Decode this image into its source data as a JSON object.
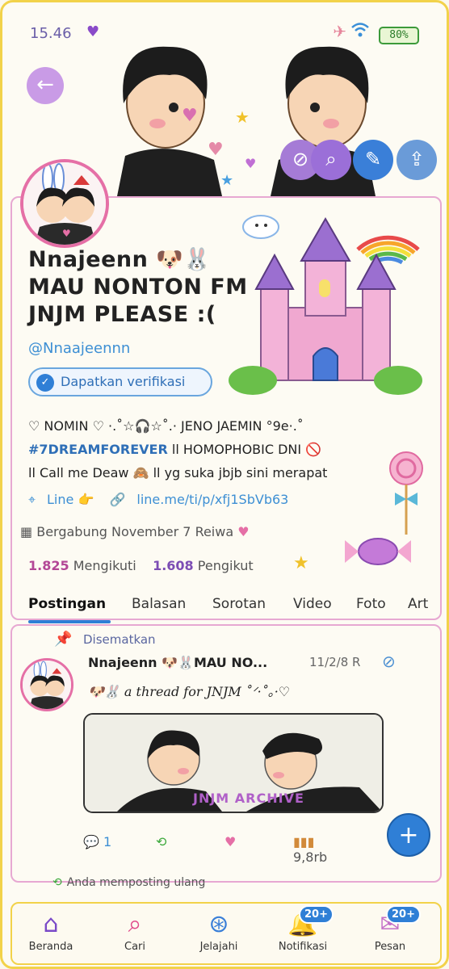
{
  "status_bar": {
    "time": "15.46",
    "battery": "80%"
  },
  "profile": {
    "display_name": "Nnajeenn 🐶🐰",
    "name_line2": "MAU NONTON FM",
    "name_line3": "JNJM PLEASE :(",
    "handle": "@Nnaajeennn",
    "verify_label": "Dapatkan verifikasi",
    "bio_line1": "♡ NOMIN ♡ ·.˚☆🎧☆˚.· JENO JAEMIN °9e·.˚",
    "bio_tag": "#7DREAMFOREVER",
    "bio_line2_rest": " ll HOMOPHOBIC DNI ",
    "bio_no_symbol": "🚫",
    "bio_line3": "ll Call me Deaw 🙈 ll yg suka jbjb sini merapat",
    "location": "Line 👉",
    "link": "line.me/ti/p/xfj1SbVb63",
    "joined": "Bergabung November 7 Reiwa",
    "following_count": "1.825",
    "following_label": "Mengikuti",
    "followers_count": "1.608",
    "followers_label": "Pengikut"
  },
  "tabs": [
    {
      "label": "Postingan"
    },
    {
      "label": "Balasan"
    },
    {
      "label": "Sorotan"
    },
    {
      "label": "Video"
    },
    {
      "label": "Foto"
    },
    {
      "label": "Art"
    }
  ],
  "post": {
    "pinned_label": "Disematkan",
    "author": "Nnajeenn 🐶🐰MAU NO...",
    "date": "11/2/8 R",
    "text": "🐶🐰 a thread for JNJM ˚ᐟ·˚｡·♡",
    "image_label": "JNJM ARCHIVE",
    "replies": "1",
    "views": "9,8rb",
    "repost_note": "Anda memposting ulang"
  },
  "bottom_nav": [
    {
      "label": "Beranda",
      "icon": "home-icon"
    },
    {
      "label": "Cari",
      "icon": "search-icon"
    },
    {
      "label": "Jelajahi",
      "icon": "compass-icon"
    },
    {
      "label": "Notifikasi",
      "icon": "bell-icon",
      "badge": "20+"
    },
    {
      "label": "Pesan",
      "icon": "envelope-icon",
      "badge": "20+"
    }
  ],
  "colors": {
    "accent_blue": "#2f7fd6",
    "frame_yellow": "#f2d24a",
    "frame_pink": "#e7a8d2",
    "avatar_ring": "#e56fa6"
  }
}
